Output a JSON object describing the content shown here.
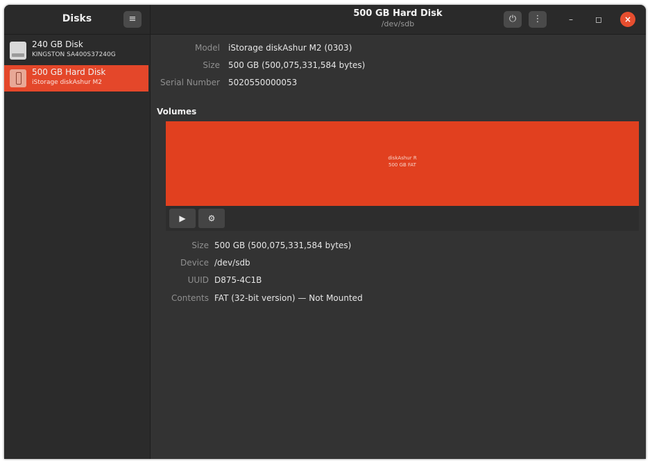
{
  "app": {
    "title": "Disks"
  },
  "header": {
    "title": "500 GB Hard Disk",
    "subtitle": "/dev/sdb",
    "icons": [
      "menu-icon",
      "power-icon",
      "more-options-icon",
      "minimize-icon",
      "maximize-icon",
      "close-icon"
    ],
    "menu_glyph": "≡",
    "power_glyph": "⏻",
    "more_glyph": "⋮",
    "minimize_glyph": "–",
    "maximize_glyph": "◻",
    "close_glyph": "×"
  },
  "sidebar": {
    "disks": [
      {
        "name": "240 GB Disk",
        "model": "KINGSTON SA400S37240G",
        "selected": false,
        "icon": "hard-disk-icon"
      },
      {
        "name": "500 GB Hard Disk",
        "model": "iStorage diskAshur M2",
        "selected": true,
        "icon": "usb-drive-icon"
      }
    ]
  },
  "drive": {
    "model_label": "Model",
    "model_value": "iStorage diskAshur M2 (0303)",
    "size_label": "Size",
    "size_value": "500 GB (500,075,331,584 bytes)",
    "serial_label": "Serial Number",
    "serial_value": "5020550000053"
  },
  "volumes": {
    "heading": "Volumes",
    "partition_name": "diskAshur R",
    "partition_desc": "500 GB FAT",
    "toolbar": {
      "play_glyph": "▶",
      "settings_glyph": "⚙"
    }
  },
  "partition_info": {
    "size_label": "Size",
    "size_value": "500 GB (500,075,331,584 bytes)",
    "device_label": "Device",
    "device_value": "/dev/sdb",
    "uuid_label": "UUID",
    "uuid_value": "D875-4C1B",
    "contents_label": "Contents",
    "contents_value": "FAT (32-bit version) — Not Mounted"
  },
  "colors": {
    "accent": "#e4472a",
    "window_bg": "#333333",
    "sidebar_bg": "#2b2b2b",
    "header_bg": "#2a2a2a",
    "close_button": "#e64e2f"
  }
}
